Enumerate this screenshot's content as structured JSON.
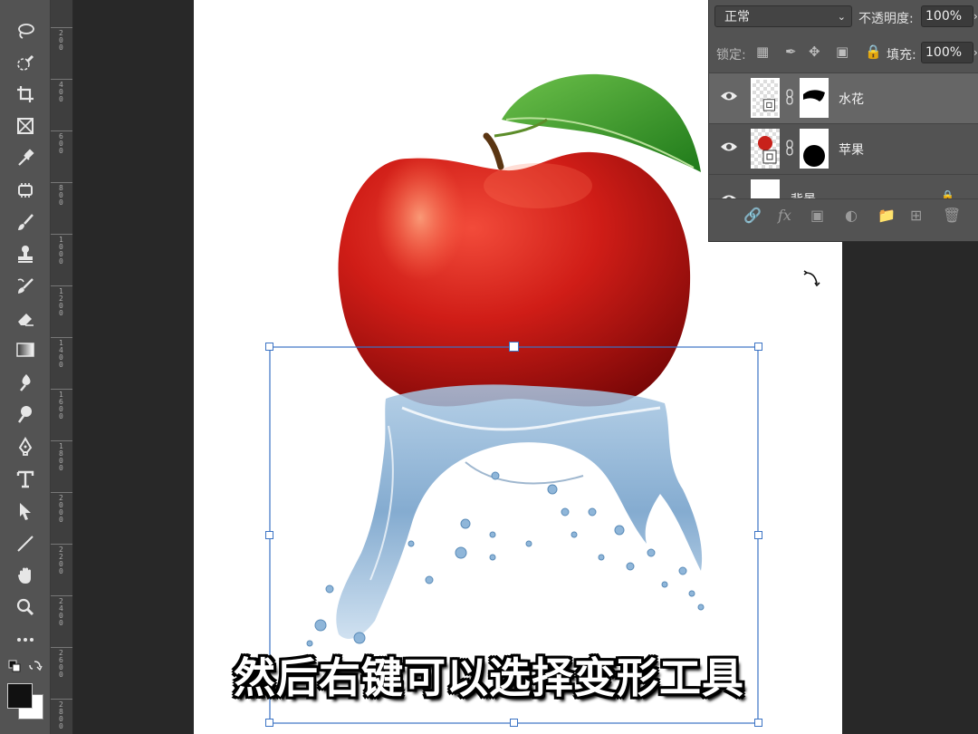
{
  "layers_panel": {
    "blend_mode": "正常",
    "opacity_label": "不透明度:",
    "opacity_value": "100%",
    "lock_label": "锁定:",
    "fill_label": "填充:",
    "fill_value": "100%",
    "layers": [
      {
        "name": "水花",
        "selected": true
      },
      {
        "name": "苹果",
        "selected": false
      },
      {
        "name": "背景",
        "selected": false
      }
    ]
  },
  "ruler": {
    "labels": [
      "200",
      "400",
      "600",
      "800",
      "1000",
      "1200",
      "1400",
      "1600",
      "1800",
      "2000",
      "2200",
      "2400",
      "2600",
      "2800"
    ]
  },
  "caption": "然后右键可以选择变形工具",
  "colors": {
    "ui_dark": "#535353",
    "canvas_bg": "#282828",
    "transform_box": "#3b73c4",
    "foreground": "#111111",
    "background": "#ffffff"
  },
  "icons": [
    "lasso-icon",
    "quick-select-icon",
    "crop-icon",
    "frame-icon",
    "eyedropper-icon",
    "patch-icon",
    "brush-icon",
    "stamp-icon",
    "history-brush-icon",
    "eraser-icon",
    "gradient-icon",
    "blur-icon",
    "dodge-icon",
    "pen-icon",
    "type-icon",
    "path-select-icon",
    "line-icon",
    "hand-icon",
    "zoom-icon",
    "more-icon"
  ]
}
